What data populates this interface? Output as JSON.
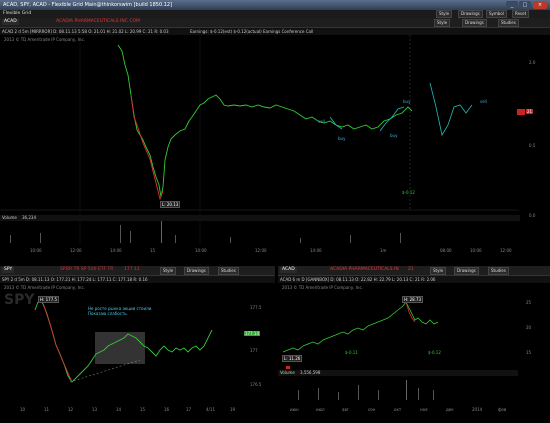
{
  "window": {
    "title": "ACAD, SPY, ACAD - Flexible Grid Main@thinkorswim [build 1850.12]",
    "tab_label": "Flexible Grid",
    "buttons": [
      "Style",
      "Drawings"
    ],
    "symbol_button": "Symbol",
    "reset_button": "Reset"
  },
  "top_panel": {
    "symbol": "ACAD",
    "ticker_text": "ACADIA PHARMACEUTICALS INC COM",
    "info": "ACAD 2 d 5m [MIRRROR]  D: 08.11.13 5:58  O: 21.01  H: 21.02  L: 20.99  C: 21  R: 0.03",
    "earnings": "Earnings: $-0.12(est) $-0.12(actual) Earnings Conference Call",
    "copyright": "2013 © TD Ameritrade IP Company, Inc.",
    "buttons": [
      "Style",
      "Drawings",
      "Studies"
    ],
    "low_label": "L: 20.13",
    "buy_labels": [
      "buy",
      "buy",
      "buy"
    ],
    "sell_labels": [
      "sell",
      "sell"
    ],
    "earnings_value": "$-0.12",
    "price_levels": [
      "2.0",
      "0.5",
      "0.0"
    ],
    "volume_label": "Volume",
    "volume_value": "36,234",
    "x_ticks": [
      "10:00",
      "12:00",
      "14:00",
      "15",
      "10:00",
      "12:00",
      "14:00",
      "1m",
      "08:00",
      "10:00",
      "12:00"
    ],
    "red_marker": "21"
  },
  "left_panel": {
    "symbol": "SPY",
    "ticker_text": "SPDR TR SP 500 ETF TR",
    "price": "177.11",
    "buttons": [
      "Style",
      "Drawings",
      "Studies"
    ],
    "info": "SPY 2 d 5m  D: 08.11.13  O: 177.21  H: 177.24  L: 177.11  C: 177.18  R: 0.16",
    "copyright": "2013 © TD Ameritrade IP Company, Inc.",
    "high_label": "H: 177.5",
    "note": "Не росте рынка акции стоили. Показаю слабость.",
    "current_price": "177.14",
    "y_ticks": [
      "177.5",
      "177",
      "176.5"
    ],
    "x_ticks": [
      "10",
      "11",
      "12",
      "13",
      "14",
      "15",
      "16",
      "17",
      "4/11",
      "19"
    ],
    "logo": "SPY"
  },
  "right_panel": {
    "symbol": "ACAD",
    "ticker_text": "ACADIA PHARMACEUTICALS IN",
    "price": "21",
    "buttons": [
      "Style",
      "Drawings",
      "Studies"
    ],
    "info": "ACAD 6 m D [GANNBOX] D: 08.11.13  O: 22.82  H: 22.79  L: 20.13  C: 21  R: 2.06",
    "earnings": "Earnings: $-0.12(est) $-0.12(actual)",
    "copyright": "2013 © TD Ameritrade IP Company, Inc.",
    "high_label": "H: 28.73",
    "low_label": "L: 11.26",
    "earnings_left": "$-0.11",
    "earnings_right": "$-0.12",
    "volume_label": "Volume",
    "volume_value": "3,556,598",
    "x_ticks": [
      "июн",
      "июл",
      "авг",
      "сен",
      "окт",
      "ноя",
      "дек",
      "2014",
      "фев"
    ],
    "y_ticks": [
      "25",
      "20",
      "15"
    ]
  }
}
